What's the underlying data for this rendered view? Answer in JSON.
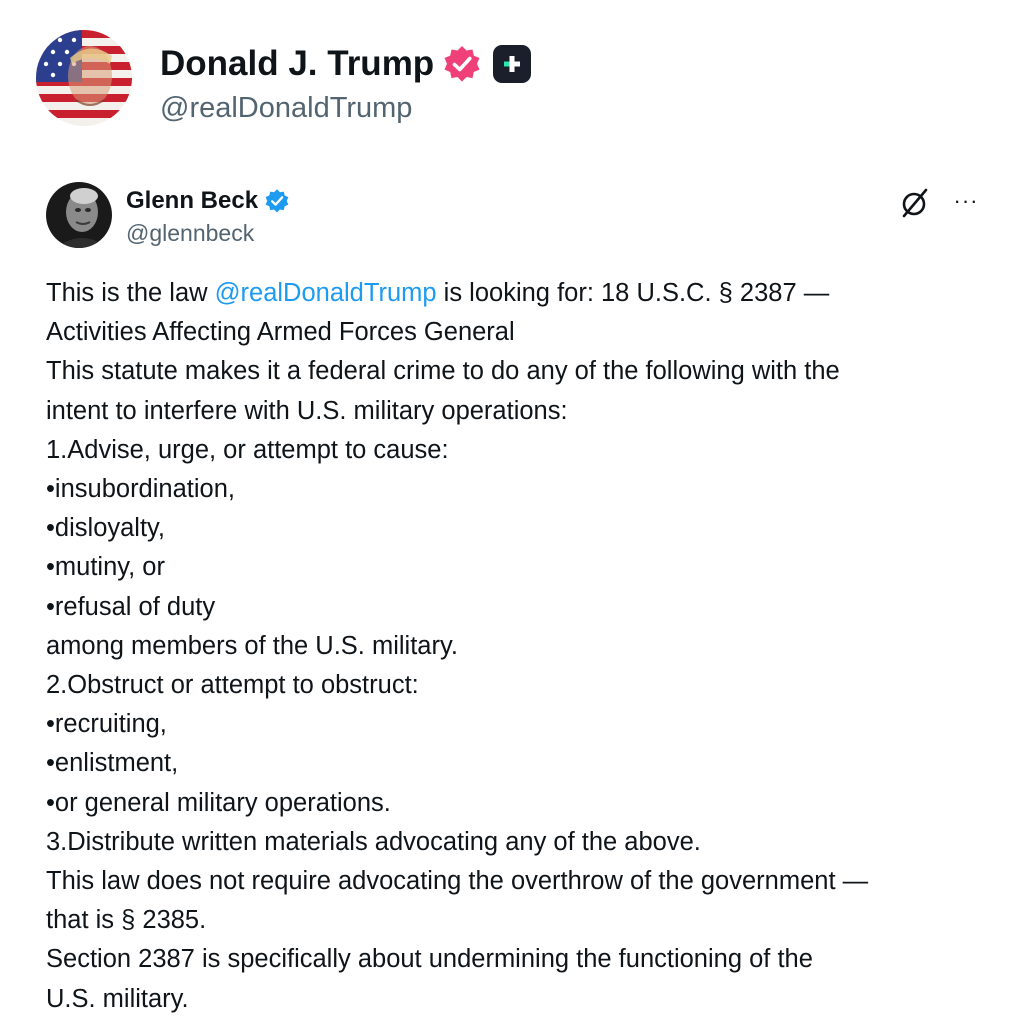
{
  "author": {
    "name": "Donald J. Trump",
    "handle": "@realDonaldTrump",
    "verified_badge_color": "#f0407a",
    "plus_badge_color": "#1a1f2b"
  },
  "quoted_post": {
    "author_name": "Glenn Beck",
    "author_handle": "@glennbeck",
    "verified_badge_color": "#1d9bf0",
    "icons": [
      "grok-icon",
      "more-icon"
    ],
    "more_label": "···",
    "intro": {
      "before_mention": "This is the law ",
      "mention": "@realDonaldTrump",
      "after_mention": " is looking for:  18 U.S.C. § 2387 —"
    },
    "lines": [
      "Activities Affecting Armed Forces General",
      "This statute makes it a federal crime to do any of the following with the",
      "intent to interfere with U.S. military operations:",
      "1.Advise, urge, or attempt to cause:",
      "•insubordination,",
      "•disloyalty,",
      "•mutiny, or",
      "•refusal of duty",
      "among members of the U.S. military.",
      "2.Obstruct or attempt to obstruct:",
      "•recruiting,",
      "•enlistment,",
      "•or general military operations.",
      "3.Distribute written materials advocating any of the above.",
      "This law does not require advocating the overthrow of the government —",
      "that is § 2385.",
      "Section 2387 is specifically about undermining the functioning of the",
      "U.S. military."
    ]
  }
}
